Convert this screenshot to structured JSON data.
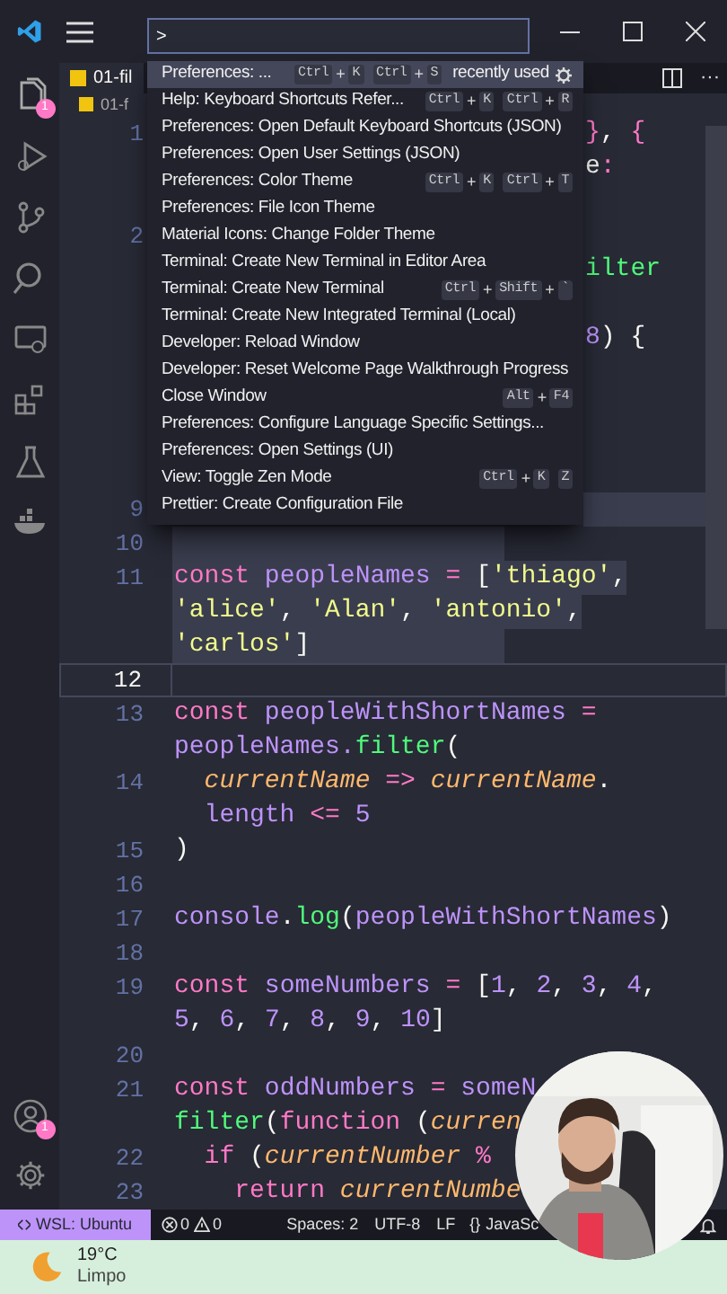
{
  "palette": {
    "input": ">",
    "items": [
      {
        "label": "Preferences: ...",
        "keys": [
          {
            "keys": [
              "Ctrl",
              "K"
            ],
            "joiner": "+"
          },
          {
            "keys": [
              "Ctrl",
              "S"
            ],
            "joiner": "+"
          }
        ],
        "note": "recently used",
        "selected": true
      },
      {
        "label": "Help: Keyboard Shortcuts Refer...",
        "keys": [
          {
            "keys": [
              "Ctrl",
              "K"
            ],
            "joiner": "+"
          },
          {
            "keys": [
              "Ctrl",
              "R"
            ],
            "joiner": "+"
          }
        ],
        "selected": false
      },
      {
        "label": "Preferences: Open Default Keyboard Shortcuts (JSON)",
        "selected": false
      },
      {
        "label": "Preferences: Open User Settings (JSON)",
        "selected": false
      },
      {
        "label": "Preferences: Color Theme",
        "keys": [
          {
            "keys": [
              "Ctrl",
              "K"
            ],
            "joiner": "+"
          },
          {
            "keys": [
              "Ctrl",
              "T"
            ],
            "joiner": "+"
          }
        ],
        "selected": false
      },
      {
        "label": "Preferences: File Icon Theme",
        "selected": false
      },
      {
        "label": "Material Icons: Change Folder Theme",
        "selected": false
      },
      {
        "label": "Terminal: Create New Terminal in Editor Area",
        "selected": false
      },
      {
        "label": "Terminal: Create New Terminal",
        "keys": [
          {
            "keys": [
              "Ctrl",
              "Shift",
              "`"
            ],
            "joiner": "+"
          }
        ],
        "selected": false
      },
      {
        "label": "Terminal: Create New Integrated Terminal (Local)",
        "selected": false
      },
      {
        "label": "Developer: Reload Window",
        "selected": false
      },
      {
        "label": "Developer: Reset Welcome Page Walkthrough Progress",
        "selected": false
      },
      {
        "label": "Close Window",
        "keys": [
          {
            "keys": [
              "Alt",
              "F4"
            ],
            "joiner": "+"
          }
        ],
        "selected": false
      },
      {
        "label": "Preferences: Configure Language Specific Settings...",
        "selected": false
      },
      {
        "label": "Preferences: Open Settings (UI)",
        "selected": false
      },
      {
        "label": "View: Toggle Zen Mode",
        "keys": [
          {
            "keys": [
              "Ctrl",
              "K"
            ],
            "joiner": "+"
          },
          {
            "keys": [
              "Z"
            ]
          }
        ],
        "selected": false
      },
      {
        "label": "Prettier: Create Configuration File",
        "selected": false
      }
    ]
  },
  "activity_bar": {
    "files_badge": "1",
    "accounts_badge": "1"
  },
  "tab": {
    "label": "01-fil"
  },
  "editor_actions": {
    "more": "···"
  },
  "breadcrumb": "01-f",
  "editor": {
    "rows": [
      {
        "kind": "partial",
        "number": "1",
        "selected": false,
        "current": false,
        "segments": [
          {
            "kind": "keyword",
            "text": "}"
          },
          {
            "kind": "punct",
            "text": ", "
          },
          {
            "kind": "keyword",
            "text": "{"
          }
        ]
      },
      {
        "kind": "partial",
        "selected": false,
        "current": false,
        "segments": [
          {
            "kind": "punct",
            "text": "e"
          },
          {
            "kind": "keyword",
            "text": ":"
          }
        ]
      },
      {
        "kind": "partial",
        "selected": false,
        "current": false
      },
      {
        "kind": "partial",
        "number": "2",
        "selected": false,
        "current": false
      },
      {
        "kind": "partial",
        "selected": false,
        "current": false,
        "segments": [
          {
            "kind": "function",
            "text": "ilter"
          }
        ]
      },
      {
        "kind": "partial",
        "selected": false,
        "current": false
      },
      {
        "kind": "partial",
        "selected": false,
        "current": false,
        "segments": [
          {
            "kind": "number",
            "text": "8"
          },
          {
            "kind": "punct",
            "text": ") {"
          }
        ]
      },
      {
        "kind": "partial",
        "selected": false,
        "current": false
      },
      {
        "kind": "partial",
        "selected": false,
        "current": false
      },
      {
        "kind": "partial",
        "selected": false,
        "current": false
      },
      {
        "kind": "partial",
        "selected": false,
        "current": false
      },
      {
        "kind": "partial",
        "number": "9",
        "selected": true,
        "current": false
      },
      {
        "kind": "code",
        "number": "10",
        "selected": true,
        "current": false
      },
      {
        "kind": "code",
        "number": "11",
        "selected": true,
        "current": false,
        "segments": [
          {
            "kind": "keyword",
            "text": "const "
          },
          {
            "kind": "variable",
            "text": "peopleNames "
          },
          {
            "kind": "keyword",
            "text": "= "
          },
          {
            "kind": "punct",
            "text": "["
          },
          {
            "kind": "string",
            "text": "'thiago'"
          },
          {
            "kind": "punct",
            "text": ","
          }
        ]
      },
      {
        "kind": "code",
        "selected": true,
        "current": false,
        "segments": [
          {
            "kind": "string",
            "text": "'alice'"
          },
          {
            "kind": "punct",
            "text": ", "
          },
          {
            "kind": "string",
            "text": "'Alan'"
          },
          {
            "kind": "punct",
            "text": ", "
          },
          {
            "kind": "string",
            "text": "'antonio'"
          },
          {
            "kind": "punct",
            "text": ","
          }
        ]
      },
      {
        "kind": "code",
        "selected": true,
        "current": false,
        "segments": [
          {
            "kind": "string",
            "text": "'carlos'"
          },
          {
            "kind": "punct",
            "text": "]"
          }
        ]
      },
      {
        "kind": "code",
        "number": "12",
        "selected": false,
        "current": true
      },
      {
        "kind": "code",
        "number": "13",
        "selected": false,
        "current": false,
        "segments": [
          {
            "kind": "keyword",
            "text": "const "
          },
          {
            "kind": "variable",
            "text": "peopleWithShortNames "
          },
          {
            "kind": "keyword",
            "text": "="
          }
        ]
      },
      {
        "kind": "code",
        "selected": false,
        "current": false,
        "segments": [
          {
            "kind": "variable",
            "text": "peopleNames."
          },
          {
            "kind": "function",
            "text": "filter"
          },
          {
            "kind": "punct",
            "text": "("
          }
        ]
      },
      {
        "kind": "code",
        "number": "14",
        "selected": false,
        "current": false,
        "segments": [
          {
            "kind": "param",
            "text": "  currentName "
          },
          {
            "kind": "keyword",
            "text": "=> "
          },
          {
            "kind": "param",
            "text": "currentName"
          },
          {
            "kind": "punct",
            "text": "."
          }
        ]
      },
      {
        "kind": "code",
        "selected": false,
        "current": false,
        "segments": [
          {
            "kind": "variable",
            "text": "  length "
          },
          {
            "kind": "keyword",
            "text": "<= "
          },
          {
            "kind": "number",
            "text": "5"
          }
        ]
      },
      {
        "kind": "code",
        "number": "15",
        "selected": false,
        "current": false,
        "segments": [
          {
            "kind": "punct",
            "text": ")"
          }
        ]
      },
      {
        "kind": "code",
        "number": "16",
        "selected": false,
        "current": false
      },
      {
        "kind": "code",
        "number": "17",
        "selected": false,
        "current": false,
        "segments": [
          {
            "kind": "variable",
            "text": "console"
          },
          {
            "kind": "punct",
            "text": "."
          },
          {
            "kind": "function",
            "text": "log"
          },
          {
            "kind": "punct",
            "text": "("
          },
          {
            "kind": "variable",
            "text": "peopleWithShortNames"
          },
          {
            "kind": "punct",
            "text": ")"
          }
        ]
      },
      {
        "kind": "code",
        "number": "18",
        "selected": false,
        "current": false
      },
      {
        "kind": "code",
        "number": "19",
        "selected": false,
        "current": false,
        "segments": [
          {
            "kind": "keyword",
            "text": "const "
          },
          {
            "kind": "variable",
            "text": "someNumbers "
          },
          {
            "kind": "keyword",
            "text": "= "
          },
          {
            "kind": "punct",
            "text": "["
          },
          {
            "kind": "number",
            "text": "1"
          },
          {
            "kind": "punct",
            "text": ", "
          },
          {
            "kind": "number",
            "text": "2"
          },
          {
            "kind": "punct",
            "text": ", "
          },
          {
            "kind": "number",
            "text": "3"
          },
          {
            "kind": "punct",
            "text": ", "
          },
          {
            "kind": "number",
            "text": "4"
          },
          {
            "kind": "punct",
            "text": ","
          }
        ]
      },
      {
        "kind": "code",
        "selected": false,
        "current": false,
        "segments": [
          {
            "kind": "number",
            "text": "5"
          },
          {
            "kind": "punct",
            "text": ", "
          },
          {
            "kind": "number",
            "text": "6"
          },
          {
            "kind": "punct",
            "text": ", "
          },
          {
            "kind": "number",
            "text": "7"
          },
          {
            "kind": "punct",
            "text": ", "
          },
          {
            "kind": "number",
            "text": "8"
          },
          {
            "kind": "punct",
            "text": ", "
          },
          {
            "kind": "number",
            "text": "9"
          },
          {
            "kind": "punct",
            "text": ", "
          },
          {
            "kind": "number",
            "text": "10"
          },
          {
            "kind": "punct",
            "text": "]"
          }
        ]
      },
      {
        "kind": "code",
        "number": "20",
        "selected": false,
        "current": false
      },
      {
        "kind": "code",
        "number": "21",
        "selected": false,
        "current": false,
        "segments": [
          {
            "kind": "keyword",
            "text": "const "
          },
          {
            "kind": "variable",
            "text": "oddNumbers "
          },
          {
            "kind": "keyword",
            "text": "= "
          },
          {
            "kind": "variable",
            "text": "someN"
          }
        ]
      },
      {
        "kind": "code",
        "selected": false,
        "current": false,
        "segments": [
          {
            "kind": "function",
            "text": "filter"
          },
          {
            "kind": "punct",
            "text": "("
          },
          {
            "kind": "keyword",
            "text": "function "
          },
          {
            "kind": "punct",
            "text": "("
          },
          {
            "kind": "param",
            "text": "curren"
          }
        ]
      },
      {
        "kind": "code",
        "number": "22",
        "selected": false,
        "current": false,
        "segments": [
          {
            "kind": "keyword",
            "text": "  if "
          },
          {
            "kind": "punct",
            "text": "("
          },
          {
            "kind": "param",
            "text": "currentNumber "
          },
          {
            "kind": "keyword",
            "text": "%"
          }
        ]
      },
      {
        "kind": "code",
        "number": "23",
        "selected": false,
        "current": false,
        "segments": [
          {
            "kind": "keyword",
            "text": "    return "
          },
          {
            "kind": "param",
            "text": "currentNumbe"
          }
        ]
      }
    ]
  },
  "status_bar": {
    "remote": "WSL: Ubuntu",
    "errors": "0",
    "warnings": "0",
    "items": [
      "Spaces: 2",
      "UTF-8",
      "LF"
    ],
    "language_icon": "{}",
    "language": "JavaSc"
  },
  "taskbar": {
    "temperature": "19°C",
    "weather": "Limpo"
  }
}
